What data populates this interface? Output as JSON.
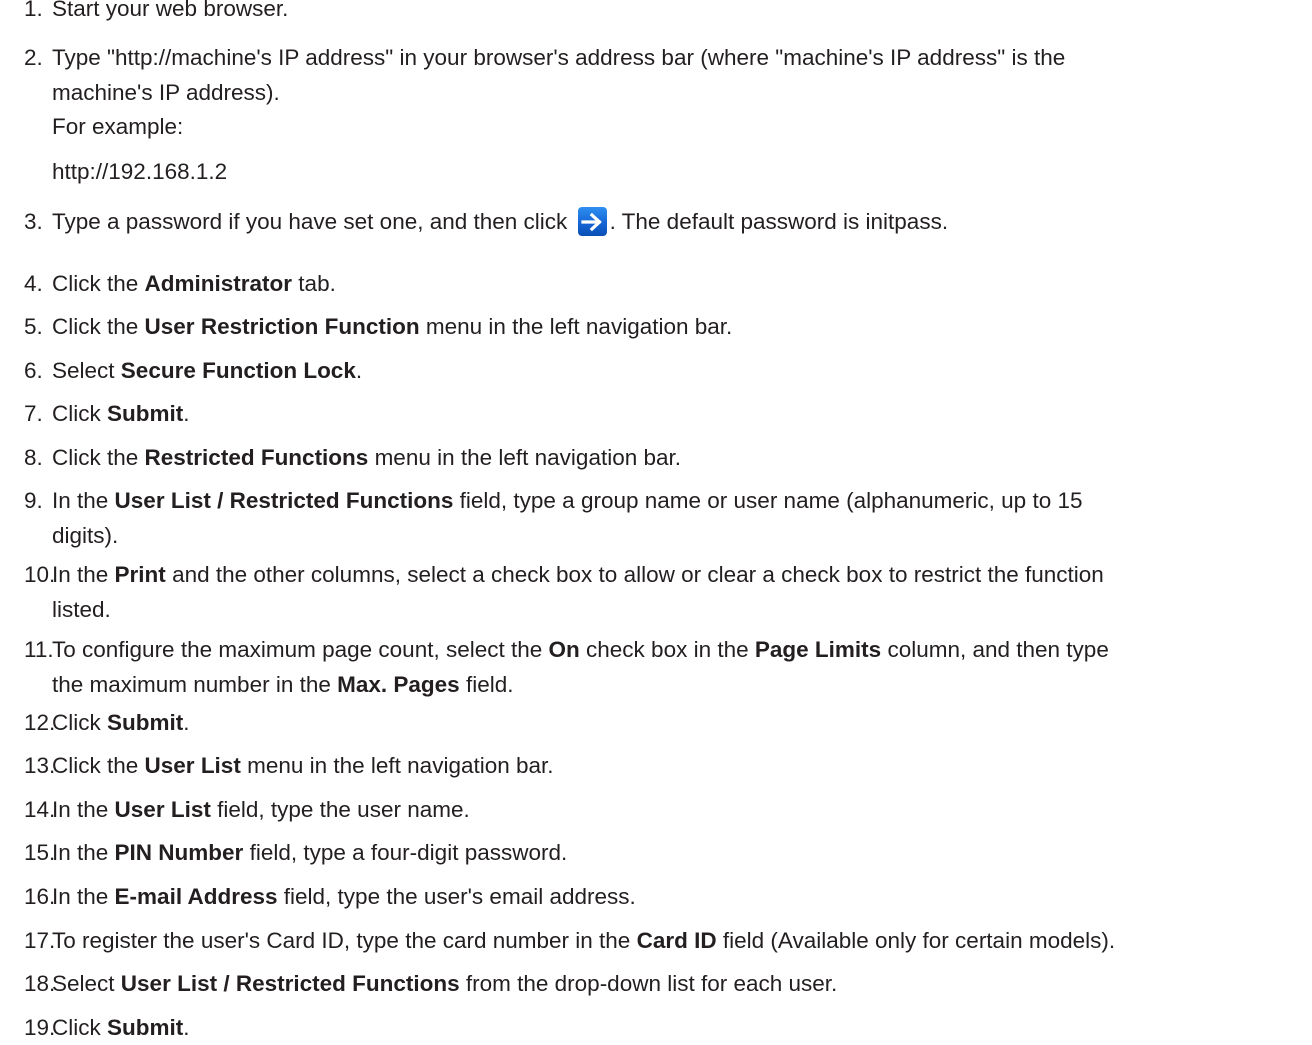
{
  "steps": [
    {
      "num": "1.",
      "lines": [
        [
          {
            "t": "Start your web browser.",
            "b": false
          }
        ]
      ]
    },
    {
      "num": "2.",
      "lines": [
        [
          {
            "t": "Type \"http://machine's IP address\" in your browser's address bar (where \"machine's IP address\" is the",
            "b": false
          }
        ],
        [
          {
            "t": "machine's IP address).",
            "b": false
          }
        ]
      ]
    },
    {
      "num": "",
      "lines": [
        [
          {
            "t": "For example:",
            "b": false
          }
        ]
      ]
    },
    {
      "num": "",
      "lines": [
        [
          {
            "t": "http://192.168.1.2",
            "b": false
          }
        ]
      ]
    },
    {
      "num": "3.",
      "lines": [
        [
          {
            "t": "Type a password if you have set one, and then click ",
            "b": false
          },
          {
            "icon": "arrow-right-icon"
          },
          {
            "t": ". The default password is initpass.",
            "b": false
          }
        ]
      ]
    },
    {
      "num": "4.",
      "lines": [
        [
          {
            "t": "Click the ",
            "b": false
          },
          {
            "t": "Administrator",
            "b": true
          },
          {
            "t": " tab.",
            "b": false
          }
        ]
      ]
    },
    {
      "num": "5.",
      "lines": [
        [
          {
            "t": "Click the ",
            "b": false
          },
          {
            "t": "User Restriction Function",
            "b": true
          },
          {
            "t": " menu in the left navigation bar.",
            "b": false
          }
        ]
      ]
    },
    {
      "num": "6.",
      "lines": [
        [
          {
            "t": "Select ",
            "b": false
          },
          {
            "t": "Secure Function Lock",
            "b": true
          },
          {
            "t": ".",
            "b": false
          }
        ]
      ]
    },
    {
      "num": "7.",
      "lines": [
        [
          {
            "t": "Click ",
            "b": false
          },
          {
            "t": "Submit",
            "b": true
          },
          {
            "t": ".",
            "b": false
          }
        ]
      ]
    },
    {
      "num": "8.",
      "lines": [
        [
          {
            "t": "Click the ",
            "b": false
          },
          {
            "t": "Restricted Functions",
            "b": true
          },
          {
            "t": " menu in the left navigation bar.",
            "b": false
          }
        ]
      ]
    },
    {
      "num": "9.",
      "lines": [
        [
          {
            "t": "In the ",
            "b": false
          },
          {
            "t": "User List / Restricted Functions",
            "b": true
          },
          {
            "t": " field, type a group name or user name (alphanumeric, up to 15",
            "b": false
          }
        ],
        [
          {
            "t": "digits).",
            "b": false
          }
        ]
      ]
    },
    {
      "num": "10.",
      "lines": [
        [
          {
            "t": "In the ",
            "b": false
          },
          {
            "t": "Print",
            "b": true
          },
          {
            "t": " and the other columns, select a check box to allow or clear a check box to restrict the function",
            "b": false
          }
        ],
        [
          {
            "t": "listed.",
            "b": false
          }
        ]
      ]
    },
    {
      "num": "11.",
      "lines": [
        [
          {
            "t": "To configure the maximum page count, select the ",
            "b": false
          },
          {
            "t": "On",
            "b": true
          },
          {
            "t": " check box in the ",
            "b": false
          },
          {
            "t": "Page Limits",
            "b": true
          },
          {
            "t": " column, and then type",
            "b": false
          }
        ],
        [
          {
            "t": "the maximum number in the ",
            "b": false
          },
          {
            "t": "Max. Pages",
            "b": true
          },
          {
            "t": " field.",
            "b": false
          }
        ]
      ]
    },
    {
      "num": "12.",
      "lines": [
        [
          {
            "t": "Click ",
            "b": false
          },
          {
            "t": "Submit",
            "b": true
          },
          {
            "t": ".",
            "b": false
          }
        ]
      ]
    },
    {
      "num": "13.",
      "lines": [
        [
          {
            "t": "Click the ",
            "b": false
          },
          {
            "t": "User List",
            "b": true
          },
          {
            "t": " menu in the left navigation bar.",
            "b": false
          }
        ]
      ]
    },
    {
      "num": "14.",
      "lines": [
        [
          {
            "t": "In the ",
            "b": false
          },
          {
            "t": "User List",
            "b": true
          },
          {
            "t": " field, type the user name.",
            "b": false
          }
        ]
      ]
    },
    {
      "num": "15.",
      "lines": [
        [
          {
            "t": "In the ",
            "b": false
          },
          {
            "t": "PIN Number",
            "b": true
          },
          {
            "t": " field, type a four-digit password.",
            "b": false
          }
        ]
      ]
    },
    {
      "num": "16.",
      "lines": [
        [
          {
            "t": "In the ",
            "b": false
          },
          {
            "t": "E-mail Address",
            "b": true
          },
          {
            "t": " field, type the user's email address.",
            "b": false
          }
        ]
      ]
    },
    {
      "num": "17.",
      "lines": [
        [
          {
            "t": "To register the user's Card ID, type the card number in the ",
            "b": false
          },
          {
            "t": "Card ID",
            "b": true
          },
          {
            "t": " field (Available only for certain models).",
            "b": false
          }
        ]
      ]
    },
    {
      "num": "18.",
      "lines": [
        [
          {
            "t": "Select ",
            "b": false
          },
          {
            "t": "User List / Restricted Functions",
            "b": true
          },
          {
            "t": " from the drop-down list for each user.",
            "b": false
          }
        ]
      ]
    },
    {
      "num": "19.",
      "lines": [
        [
          {
            "t": "Click ",
            "b": false
          },
          {
            "t": "Submit",
            "b": true
          },
          {
            "t": ".",
            "b": false
          }
        ]
      ]
    }
  ]
}
